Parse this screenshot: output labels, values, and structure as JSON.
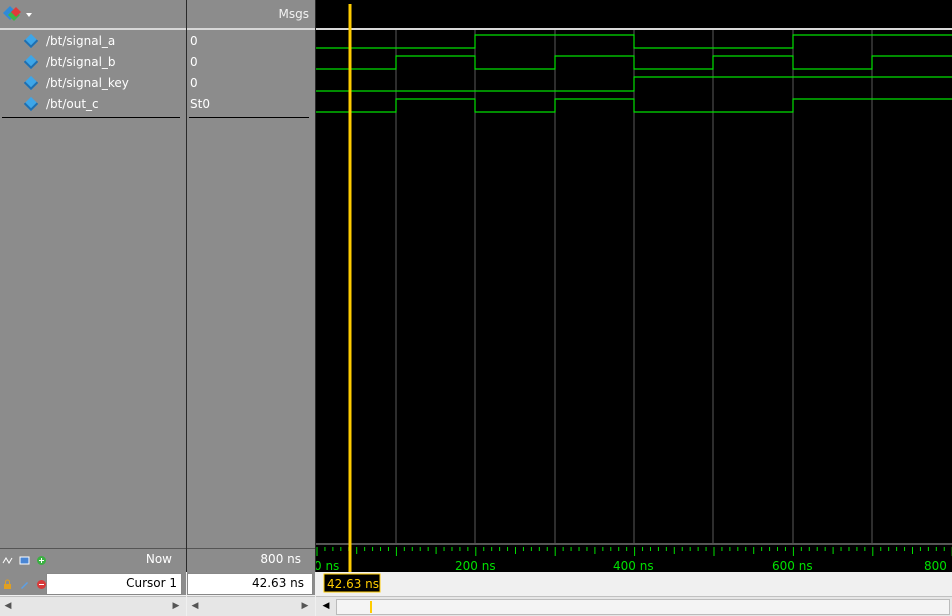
{
  "header": {
    "msgs_label": "Msgs"
  },
  "signals": [
    {
      "name": "/bt/signal_a",
      "value": "0"
    },
    {
      "name": "/bt/signal_b",
      "value": "0"
    },
    {
      "name": "/bt/signal_key",
      "value": "0"
    },
    {
      "name": "/bt/out_c",
      "value": "St0"
    }
  ],
  "status": {
    "now_label": "Now",
    "now_value": "800 ns",
    "cursor_label": "Cursor 1",
    "cursor_value": "42.63 ns",
    "cursor_flag": "42.63 ns"
  },
  "timeline": {
    "tick_labels": [
      "0 ns",
      "200 ns",
      "400 ns",
      "600 ns",
      "800"
    ]
  },
  "colors": {
    "wave": "#00ff00",
    "cursor": "#ffcc00",
    "grid": "#5a5a5a",
    "pane_bg": "#8c8c8c"
  },
  "icons": {
    "wave_menu": "diamond-dropdown-icon",
    "signal": "blue-diamond-icon"
  }
}
